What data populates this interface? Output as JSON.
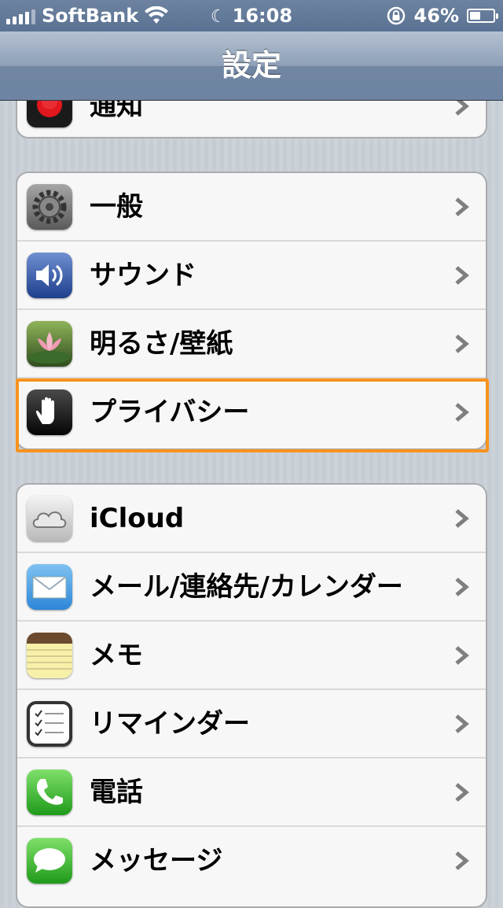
{
  "status_bar": {
    "carrier": "SoftBank",
    "time": "16:08",
    "battery_percent": "46%",
    "battery_level": 0.46,
    "icons": [
      "signal-bars-icon",
      "wifi-icon",
      "moon-icon",
      "rotation-lock-icon",
      "battery-icon"
    ]
  },
  "nav": {
    "title": "設定"
  },
  "top_group": {
    "rows": [
      {
        "label": "通知",
        "icon": "notifications-icon"
      }
    ]
  },
  "group1": {
    "rows": [
      {
        "label": "一般",
        "icon": "general-gear-icon"
      },
      {
        "label": "サウンド",
        "icon": "sound-speaker-icon"
      },
      {
        "label": "明るさ/壁紙",
        "icon": "brightness-wallpaper-icon"
      },
      {
        "label": "プライバシー",
        "icon": "privacy-hand-icon"
      }
    ]
  },
  "group2": {
    "rows": [
      {
        "label": "iCloud",
        "icon": "icloud-icon"
      },
      {
        "label": "メール/連絡先/カレンダー",
        "icon": "mail-icon"
      },
      {
        "label": "メモ",
        "icon": "notes-icon"
      },
      {
        "label": "リマインダー",
        "icon": "reminders-icon"
      },
      {
        "label": "電話",
        "icon": "phone-icon"
      },
      {
        "label": "メッセージ",
        "icon": "messages-icon"
      }
    ]
  },
  "colors": {
    "highlight": "#f7931e",
    "nav_bar": "#7186a3",
    "background": "#c5ccd4"
  }
}
